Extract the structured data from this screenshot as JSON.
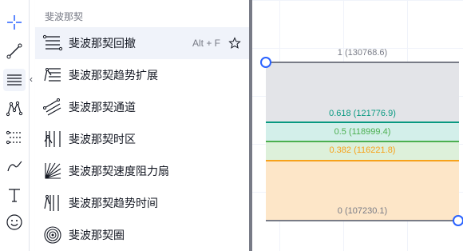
{
  "panel": {
    "header": "斐波那契",
    "items": [
      {
        "icon": "fib-retracement-icon",
        "label": "斐波那契回撤",
        "shortcut": "Alt + F",
        "favorite_icon": "star-outline-icon"
      },
      {
        "icon": "fib-trend-extension-icon",
        "label": "斐波那契趋势扩展"
      },
      {
        "icon": "fib-channel-icon",
        "label": "斐波那契通道"
      },
      {
        "icon": "fib-time-zone-icon",
        "label": "斐波那契时区"
      },
      {
        "icon": "fib-speed-fan-icon",
        "label": "斐波那契速度阻力扇"
      },
      {
        "icon": "fib-trend-time-icon",
        "label": "斐波那契趋势时间"
      },
      {
        "icon": "fib-circles-icon",
        "label": "斐波那契圈"
      }
    ]
  },
  "toolbar": {
    "tools": [
      "crosshair-icon",
      "trend-line-icon",
      "fib-tools-icon",
      "pattern-icon",
      "forecast-icon",
      "brush-icon",
      "text-icon",
      "emoji-icon"
    ]
  },
  "fib_levels": [
    {
      "ratio": "1",
      "price": "130768.6",
      "label": "1 (130768.6)",
      "color": "#787b86"
    },
    {
      "ratio": "0.618",
      "price": "121776.9",
      "label": "0.618 (121776.9)",
      "color": "#089981"
    },
    {
      "ratio": "0.5",
      "price": "118999.4",
      "label": "0.5 (118999.4)",
      "color": "#4caf50"
    },
    {
      "ratio": "0.382",
      "price": "116221.8",
      "label": "0.382 (116221.8)",
      "color": "#f7a21b"
    },
    {
      "ratio": "0",
      "price": "107230.1",
      "label": "0 (107230.1)",
      "color": "#787b86"
    }
  ],
  "colors": {
    "accent": "#2962ff",
    "band_top": "#e3e4e8",
    "band_618": "#d3efea",
    "band_5": "#ddf0da",
    "band_382": "#fde6c8"
  }
}
